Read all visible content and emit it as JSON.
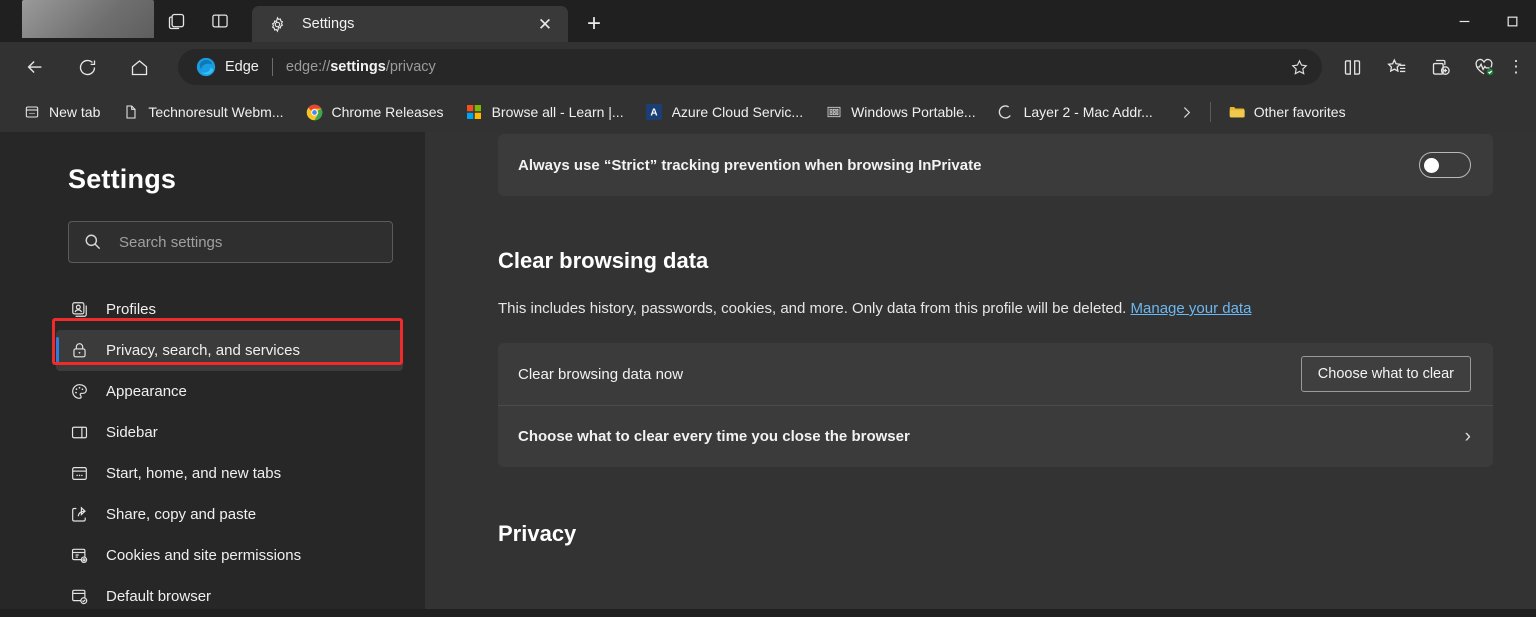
{
  "window": {
    "minimize_label": "Minimize",
    "maximize_label": "Maximize",
    "tab_search_icon": "tab-search-icon",
    "split_screen_icon": "split-screen-icon"
  },
  "tabs": [
    {
      "title": "Settings",
      "icon": "gear-icon",
      "close_label": "✕",
      "active": true
    }
  ],
  "new_tab_label": "+",
  "toolbar": {
    "back_label": "Back",
    "refresh_label": "Refresh",
    "home_label": "Home",
    "brand": "Edge",
    "url_prefix": "edge://",
    "url_bold": "settings",
    "url_suffix": "/privacy",
    "favorite_icon": "star-icon",
    "split_screen_icon": "split-screen-icon",
    "favorites_icon": "favorites-star-list-icon",
    "collections_icon": "collections-icon",
    "browser_essentials_icon": "browser-essentials-icon",
    "more_icon": "more-vertical-icon"
  },
  "bookmarks": {
    "items": [
      {
        "label": "New tab",
        "icon": "new-tab-icon"
      },
      {
        "label": "Technoresult Webm...",
        "icon": "document-icon"
      },
      {
        "label": "Chrome Releases",
        "icon": "chrome-icon"
      },
      {
        "label": "Browse all - Learn |...",
        "icon": "microsoft-icon"
      },
      {
        "label": "Azure Cloud Servic...",
        "icon": "azure-a-icon"
      },
      {
        "label": "Windows Portable...",
        "icon": "windows-portable-icon"
      },
      {
        "label": "Layer 2 - Mac Addr...",
        "icon": "partial-circle-icon"
      }
    ],
    "overflow_icon": "chevron-right-icon",
    "other_favorites": {
      "label": "Other favorites",
      "icon": "folder-icon"
    }
  },
  "sidebar": {
    "title": "Settings",
    "search": {
      "placeholder": "Search settings",
      "icon": "search-icon"
    },
    "items": [
      {
        "label": "Profiles",
        "icon": "profile-icon",
        "selected": false
      },
      {
        "label": "Privacy, search, and services",
        "icon": "lock-icon",
        "selected": true
      },
      {
        "label": "Appearance",
        "icon": "palette-icon",
        "selected": false
      },
      {
        "label": "Sidebar",
        "icon": "sidebar-icon",
        "selected": false
      },
      {
        "label": "Start, home, and new tabs",
        "icon": "start-home-icon",
        "selected": false
      },
      {
        "label": "Share, copy and paste",
        "icon": "share-icon",
        "selected": false
      },
      {
        "label": "Cookies and site permissions",
        "icon": "cookies-permissions-icon",
        "selected": false
      },
      {
        "label": "Default browser",
        "icon": "default-browser-icon",
        "selected": false
      }
    ]
  },
  "main": {
    "inprivate_row": {
      "label": "Always use “Strict” tracking prevention when browsing InPrivate",
      "toggle_on": false
    },
    "clear_browsing_data": {
      "heading": "Clear browsing data",
      "description_before": "This includes history, passwords, cookies, and more. Only data from this profile will be deleted. ",
      "manage_link": "Manage your data",
      "row_now_label": "Clear browsing data now",
      "choose_button": "Choose what to clear",
      "row_every_time_label": "Choose what to clear every time you close the browser",
      "chevron": "›"
    },
    "privacy_heading": "Privacy"
  },
  "annotations": {
    "color": "#f02b2b",
    "targets": [
      "sidebar-item-privacy-search-and-services",
      "choose-what-to-clear-button"
    ]
  }
}
